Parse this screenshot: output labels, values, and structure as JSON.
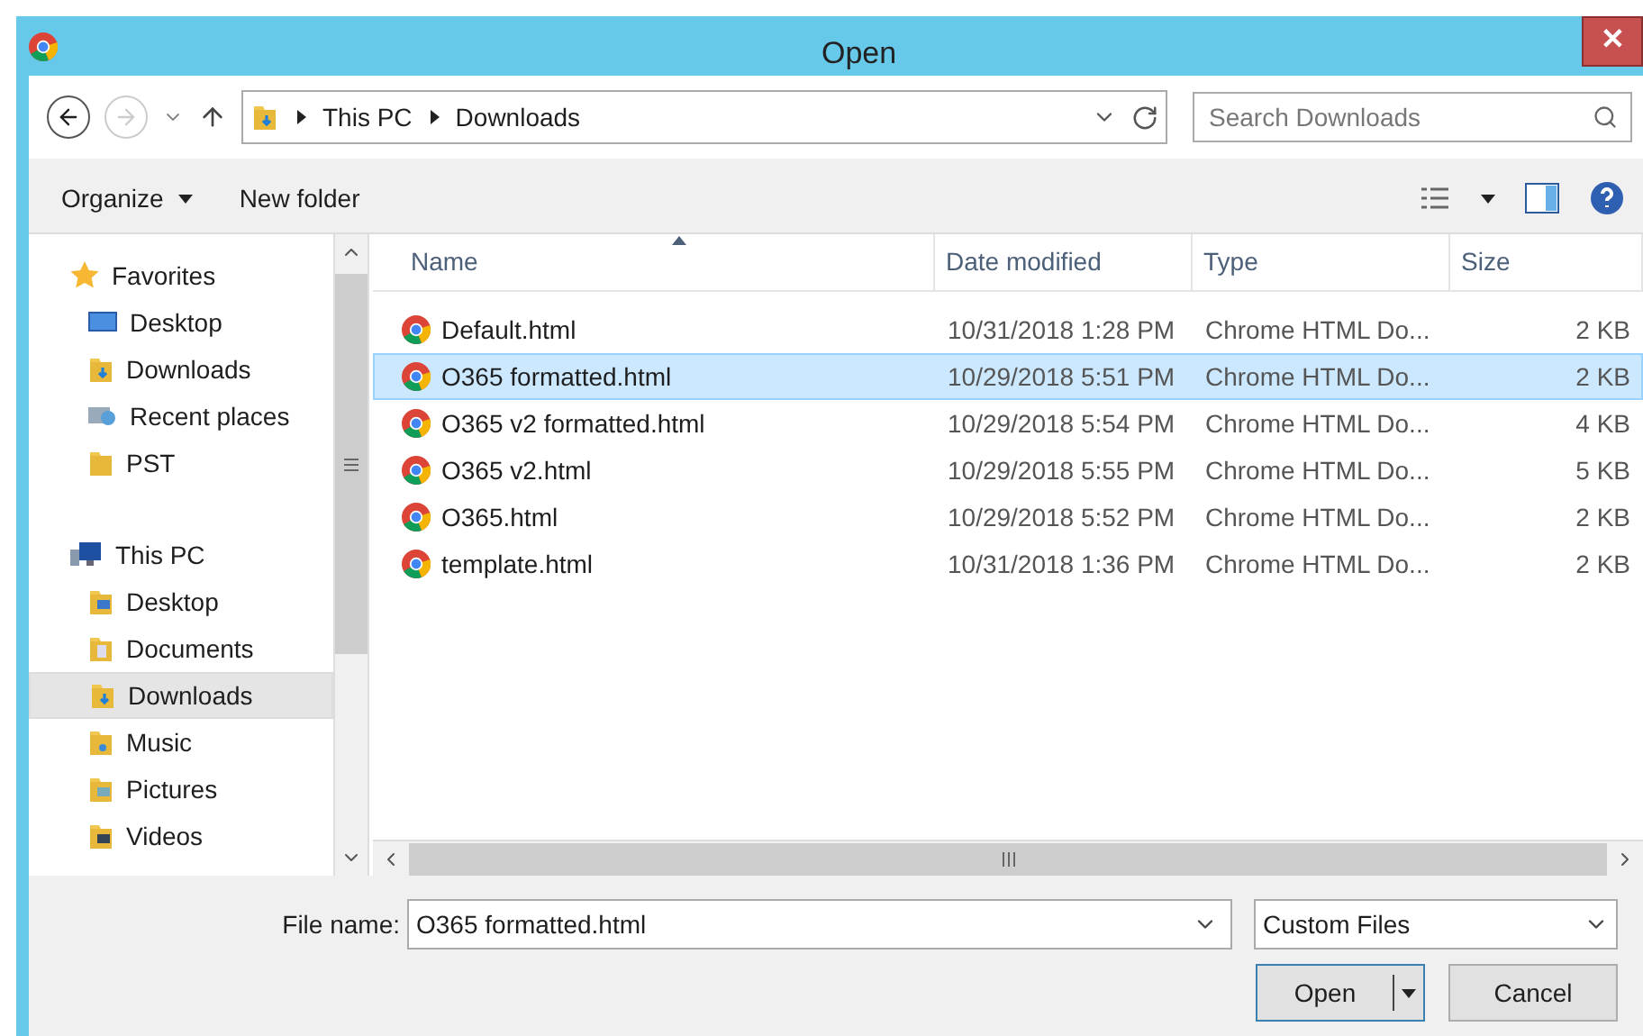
{
  "window": {
    "title": "Open",
    "close": "✕"
  },
  "address": {
    "path": [
      "This PC",
      "Downloads"
    ],
    "search_placeholder": "Search Downloads"
  },
  "toolbar": {
    "organize": "Organize",
    "new_folder": "New folder"
  },
  "nav": [
    {
      "kind": "group",
      "label": "Favorites",
      "selected": false
    },
    {
      "kind": "item",
      "label": "Desktop",
      "selected": false
    },
    {
      "kind": "item",
      "label": "Downloads",
      "selected": false
    },
    {
      "kind": "item",
      "label": "Recent places",
      "selected": false
    },
    {
      "kind": "item",
      "label": "PST",
      "selected": false
    },
    {
      "kind": "spacer"
    },
    {
      "kind": "group",
      "label": "This PC",
      "selected": false
    },
    {
      "kind": "item",
      "label": "Desktop",
      "selected": false
    },
    {
      "kind": "item",
      "label": "Documents",
      "selected": false
    },
    {
      "kind": "item",
      "label": "Downloads",
      "selected": true
    },
    {
      "kind": "item",
      "label": "Music",
      "selected": false
    },
    {
      "kind": "item",
      "label": "Pictures",
      "selected": false
    },
    {
      "kind": "item",
      "label": "Videos",
      "selected": false
    }
  ],
  "table": {
    "columns": [
      "Name",
      "Date modified",
      "Type",
      "Size"
    ],
    "rows": [
      {
        "name": "Default.html",
        "date": "10/31/2018 1:28 PM",
        "type": "Chrome HTML Do...",
        "size": "2 KB",
        "selected": false
      },
      {
        "name": "O365 formatted.html",
        "date": "10/29/2018 5:51 PM",
        "type": "Chrome HTML Do...",
        "size": "2 KB",
        "selected": true
      },
      {
        "name": "O365 v2 formatted.html",
        "date": "10/29/2018 5:54 PM",
        "type": "Chrome HTML Do...",
        "size": "4 KB",
        "selected": false
      },
      {
        "name": "O365 v2.html",
        "date": "10/29/2018 5:55 PM",
        "type": "Chrome HTML Do...",
        "size": "5 KB",
        "selected": false
      },
      {
        "name": "O365.html",
        "date": "10/29/2018 5:52 PM",
        "type": "Chrome HTML Do...",
        "size": "2 KB",
        "selected": false
      },
      {
        "name": "template.html",
        "date": "10/31/2018 1:36 PM",
        "type": "Chrome HTML Do...",
        "size": "2 KB",
        "selected": false
      }
    ]
  },
  "footer": {
    "file_name_label": "File name:",
    "file_name": "O365 formatted.html",
    "filter": "Custom Files",
    "open": "Open",
    "cancel": "Cancel"
  }
}
